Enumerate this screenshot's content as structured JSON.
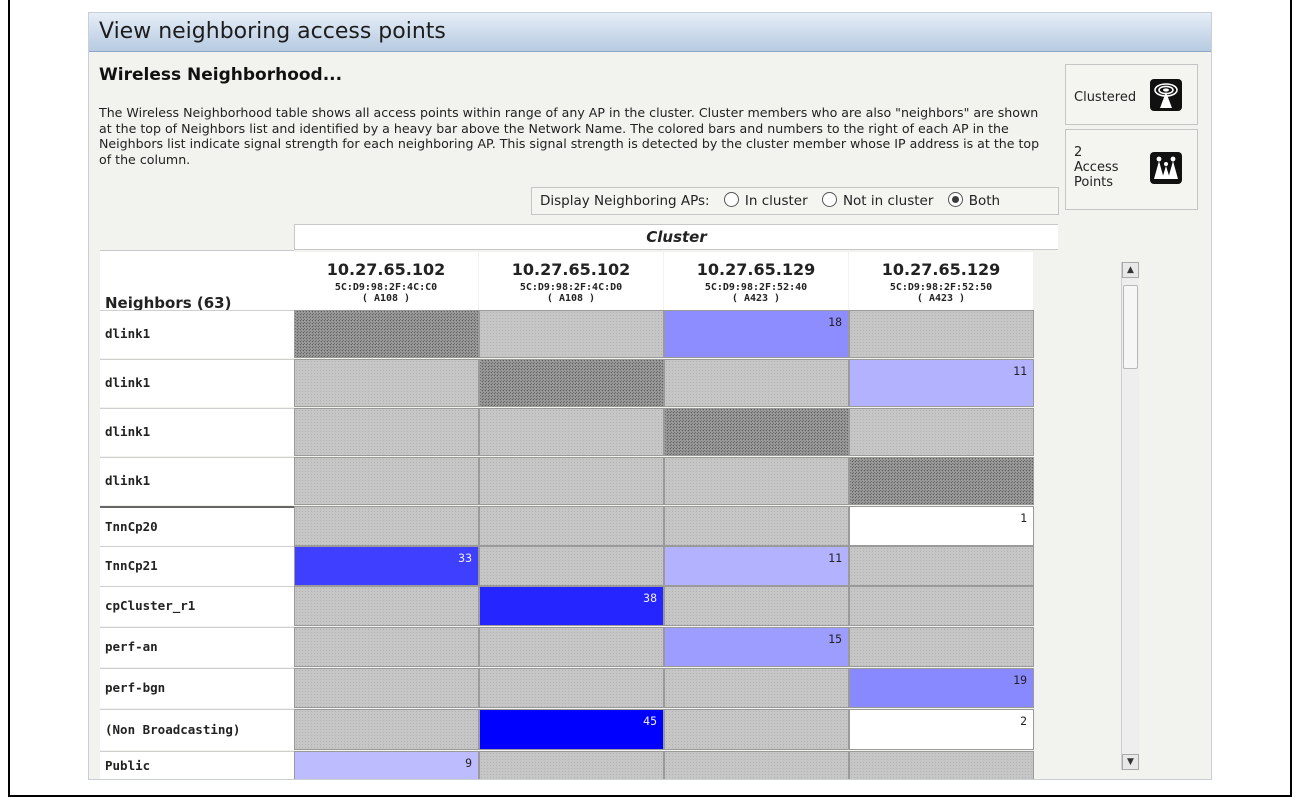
{
  "window": {
    "title": "View neighboring access points"
  },
  "section": {
    "title": "Wireless Neighborhood...",
    "description": "The Wireless Neighborhood table shows all access points within range of any AP in the cluster. Cluster members who are also \"neighbors\" are shown at the top of Neighbors list and identified by a heavy bar above the Network Name. The colored bars and numbers to the right of each AP in the Neighbors list indicate signal strength for each neighboring AP. This signal strength is detected by the cluster member whose IP address is at the top of the column."
  },
  "filter": {
    "label": "Display Neighboring APs:",
    "options": [
      {
        "label": "In cluster",
        "selected": false
      },
      {
        "label": "Not in cluster",
        "selected": false
      },
      {
        "label": "Both",
        "selected": true
      }
    ]
  },
  "sidebar": {
    "clustered_label": "Clustered",
    "clustered_icon": "wireless-ap-icon",
    "ap_count_line1": "2",
    "ap_count_line2": "Access",
    "ap_count_line3": "Points",
    "ap_icon": "access-points-icon"
  },
  "table": {
    "cluster_header": "Cluster",
    "neighbors_header": "Neighbors (63)",
    "columns": [
      {
        "ip": "10.27.65.102",
        "mac": "5C:D9:98:2F:4C:C0",
        "loc": "( A108 )"
      },
      {
        "ip": "10.27.65.102",
        "mac": "5C:D9:98:2F:4C:D0",
        "loc": "( A108 )"
      },
      {
        "ip": "10.27.65.129",
        "mac": "5C:D9:98:2F:52:40",
        "loc": "( A423 )"
      },
      {
        "ip": "10.27.65.129",
        "mac": "5C:D9:98:2F:52:50",
        "loc": "( A423 )"
      }
    ],
    "rows": [
      {
        "name": "dlink1",
        "cells": [
          "self",
          "",
          "18",
          ""
        ]
      },
      {
        "name": "dlink1",
        "cells": [
          "",
          "self",
          "",
          "11"
        ]
      },
      {
        "name": "dlink1",
        "cells": [
          "",
          "",
          "self",
          ""
        ]
      },
      {
        "name": "dlink1",
        "cells": [
          "",
          "",
          "",
          "self"
        ]
      },
      {
        "name": "TnnCp20",
        "cells": [
          "",
          "",
          "",
          "1"
        ]
      },
      {
        "name": "TnnCp21",
        "cells": [
          "33",
          "",
          "11",
          ""
        ]
      },
      {
        "name": "cpCluster_r1",
        "cells": [
          "",
          "38",
          "",
          ""
        ]
      },
      {
        "name": "perf-an",
        "cells": [
          "",
          "",
          "15",
          ""
        ]
      },
      {
        "name": "perf-bgn",
        "cells": [
          "",
          "",
          "",
          "19"
        ]
      },
      {
        "name": "(Non Broadcasting)",
        "cells": [
          "",
          "45",
          "",
          "2"
        ]
      },
      {
        "name": "Public",
        "cells": [
          "9",
          "",
          "",
          ""
        ]
      }
    ]
  },
  "colors": {
    "signal_strong": "#0000ff",
    "signal_weak": "#e8e8ff",
    "no_signal": "#c6c6c6",
    "header_gradient": "#c9d8ea"
  }
}
